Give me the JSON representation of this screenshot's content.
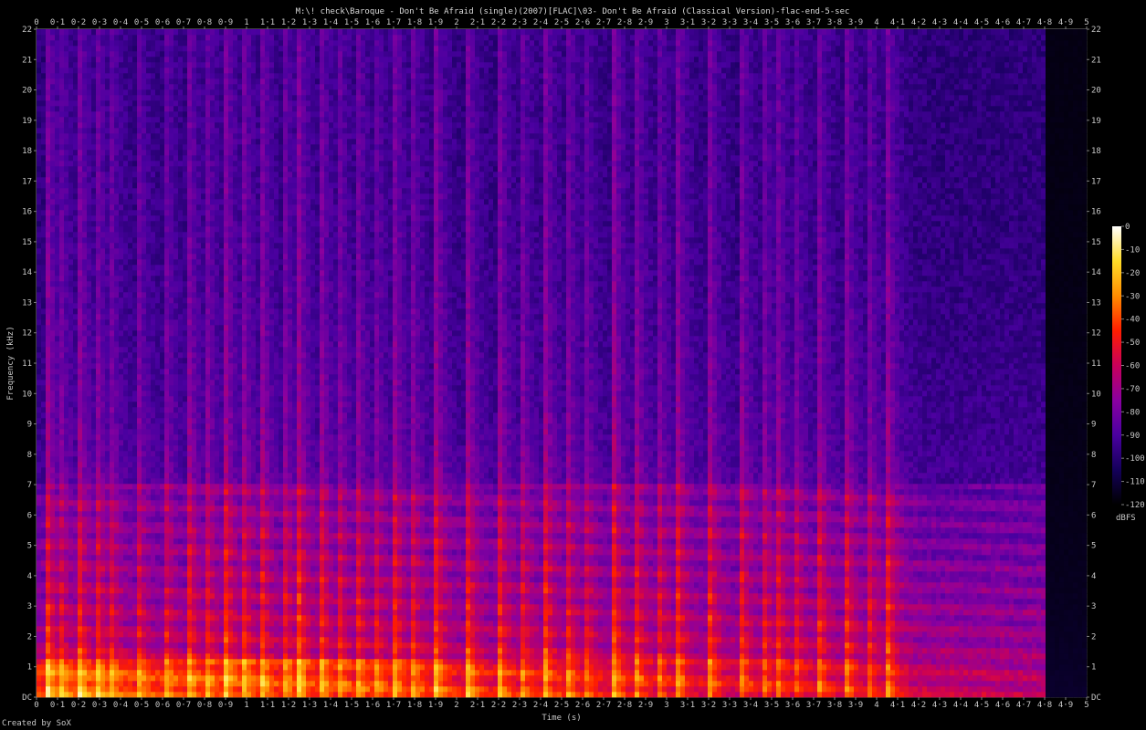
{
  "chart_data": {
    "type": "heatmap",
    "title": "M:\\! check\\Baroque - Don't Be Afraid (single)(2007)[FLAC]\\03- Don't Be Afraid (Classical Version)-flac-end-5-sec",
    "xlabel": "Time (s)",
    "ylabel": "Frequency (kHz)",
    "xlim": [
      0,
      5
    ],
    "ylim": [
      0,
      22
    ],
    "x_ticks": [
      "0",
      "0·1",
      "0·2",
      "0·3",
      "0·4",
      "0·5",
      "0·6",
      "0·7",
      "0·8",
      "0·9",
      "1",
      "1·1",
      "1·2",
      "1·3",
      "1·4",
      "1·5",
      "1·6",
      "1·7",
      "1·8",
      "1·9",
      "2",
      "2·1",
      "2·2",
      "2·3",
      "2·4",
      "2·5",
      "2·6",
      "2·7",
      "2·8",
      "2·9",
      "3",
      "3·1",
      "3·2",
      "3·3",
      "3·4",
      "3·5",
      "3·6",
      "3·7",
      "3·8",
      "3·9",
      "4",
      "4·1",
      "4·2",
      "4·3",
      "4·4",
      "4·5",
      "4·6",
      "4·7",
      "4·8",
      "4·9",
      "5"
    ],
    "y_ticks": [
      "DC",
      "1",
      "2",
      "3",
      "4",
      "5",
      "6",
      "7",
      "8",
      "9",
      "10",
      "11",
      "12",
      "13",
      "14",
      "15",
      "16",
      "17",
      "18",
      "19",
      "20",
      "21",
      "22"
    ],
    "colorbar": {
      "label": "dBFS",
      "range": [
        -120,
        0
      ],
      "ticks": [
        "0",
        "-10",
        "-20",
        "-30",
        "-40",
        "-50",
        "-60",
        "-70",
        "-80",
        "-90",
        "-100",
        "-110",
        "-120"
      ],
      "colors": [
        "#000000",
        "#14005a",
        "#4a00a0",
        "#8a00a0",
        "#c8005a",
        "#ff1e00",
        "#ff8c00",
        "#ffdc28",
        "#ffffff"
      ]
    },
    "onsets_s": [
      0.05,
      0.1,
      0.2,
      0.28,
      0.34,
      0.47,
      0.6,
      0.72,
      0.8,
      0.9,
      0.98,
      1.07,
      1.17,
      1.25,
      1.35,
      1.43,
      1.52,
      1.6,
      1.7,
      1.78,
      1.9,
      2.05,
      2.2,
      2.3,
      2.42,
      2.52,
      2.6,
      2.75,
      2.85,
      2.95,
      3.05,
      3.2,
      3.35,
      3.45,
      3.52,
      3.6,
      3.72,
      3.85,
      3.95,
      4.05
    ],
    "note": ""
  },
  "footer": {
    "credit": "Created by SoX"
  }
}
